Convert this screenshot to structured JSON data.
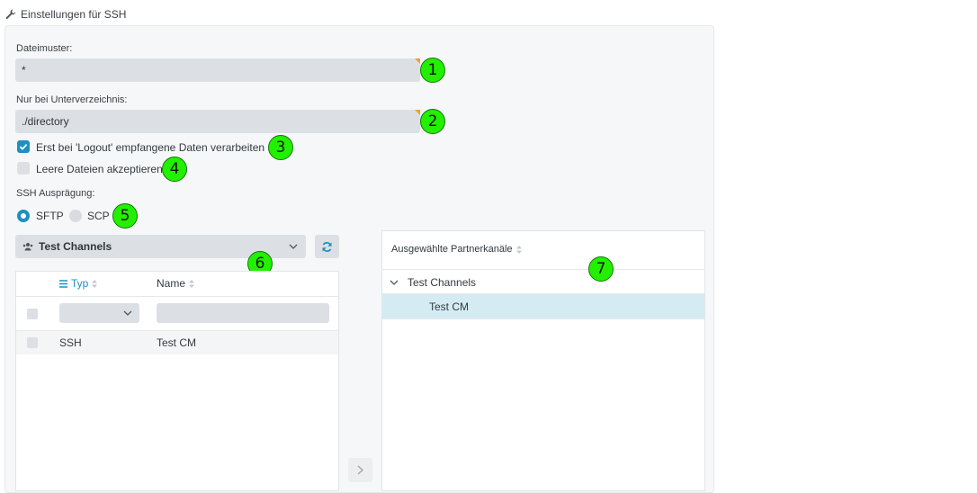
{
  "header": {
    "title": "Einstellungen für SSH",
    "icon": "wrench-icon"
  },
  "file_pattern": {
    "label": "Dateimuster:",
    "value": "*"
  },
  "subdirectory": {
    "label": "Nur bei Unterverzeichnis:",
    "value": "./directory"
  },
  "checkboxes": {
    "logout": {
      "label": "Erst bei 'Logout' empfangene Daten verarbeiten",
      "checked": true
    },
    "empty_files": {
      "label": "Leere Dateien akzeptieren",
      "checked": false
    }
  },
  "ssh_type": {
    "label": "SSH Ausprägung:",
    "options": [
      {
        "label": "SFTP",
        "selected": true
      },
      {
        "label": "SCP",
        "selected": false
      }
    ]
  },
  "channel_select": {
    "value": "Test Channels",
    "icon": "users-icon"
  },
  "left_table": {
    "columns": {
      "type": "Typ",
      "name": "Name"
    },
    "rows": [
      {
        "type": "SSH",
        "name": "Test CM"
      }
    ]
  },
  "right_panel": {
    "header": "Ausgewählte Partnerkanäle",
    "group": "Test Channels",
    "items": [
      "Test CM"
    ]
  },
  "badges": [
    "1",
    "2",
    "3",
    "4",
    "5",
    "6",
    "7"
  ],
  "colors": {
    "accent": "#1f8fc0",
    "badge": "#22f000",
    "selection": "#d5ebf3"
  }
}
